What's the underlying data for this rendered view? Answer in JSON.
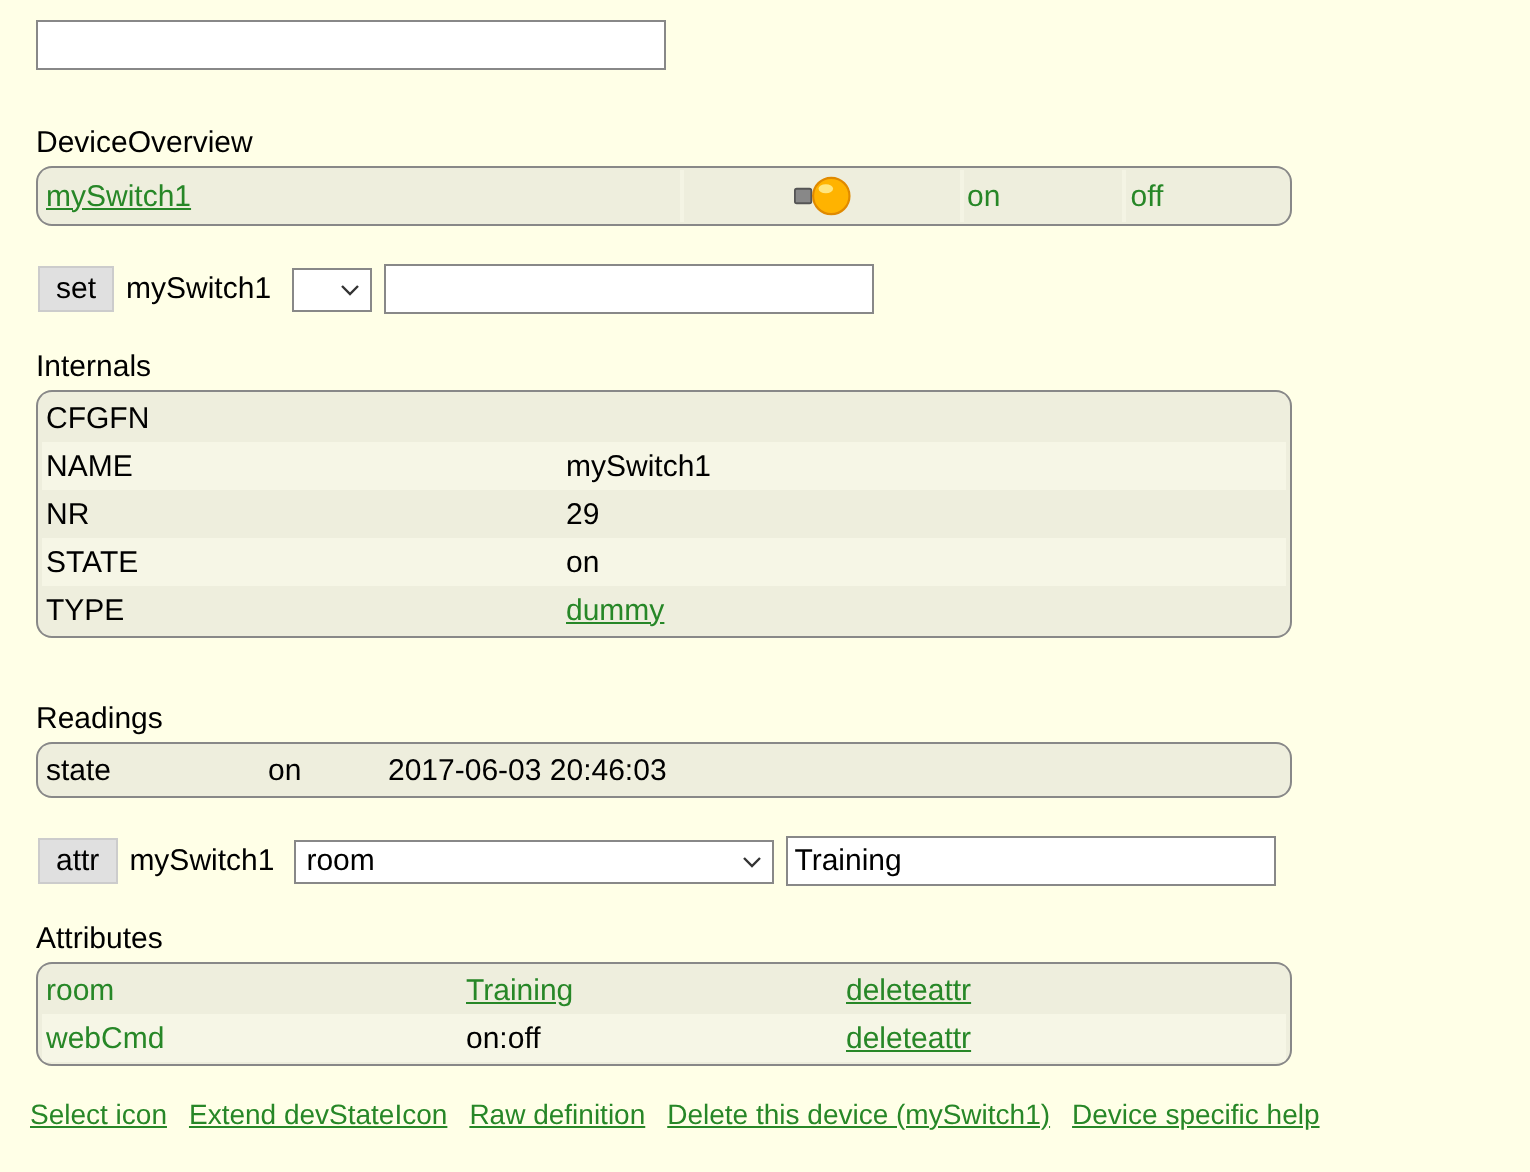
{
  "overview": {
    "title": "DeviceOverview",
    "device": "mySwitch1",
    "state_on": true,
    "commands": [
      "on",
      "off"
    ]
  },
  "set_row": {
    "button": "set",
    "device": "mySwitch1"
  },
  "internals": {
    "title": "Internals",
    "rows": [
      {
        "name": "CFGFN",
        "value": null
      },
      {
        "name": "NAME",
        "value": "mySwitch1",
        "link": false
      },
      {
        "name": "NR",
        "value": "29",
        "link": false
      },
      {
        "name": "STATE",
        "value": "on",
        "link": false
      },
      {
        "name": "TYPE",
        "value": "dummy",
        "link": true
      }
    ]
  },
  "readings": {
    "title": "Readings",
    "rows": [
      {
        "name": "state",
        "value": "on",
        "time": "2017-06-03 20:46:03"
      }
    ]
  },
  "attr_row": {
    "button": "attr",
    "device": "mySwitch1",
    "attribute": "room",
    "value": "Training"
  },
  "attributes": {
    "title": "Attributes",
    "rows": [
      {
        "name": "room",
        "value": "Training",
        "link": true,
        "action": "deleteattr"
      },
      {
        "name": "webCmd",
        "value": "on:off",
        "link": false,
        "action": "deleteattr"
      }
    ]
  },
  "links": [
    "Select icon",
    "Extend devStateIcon",
    "Raw definition",
    "Delete this device (mySwitch1)",
    "Device specific help"
  ]
}
